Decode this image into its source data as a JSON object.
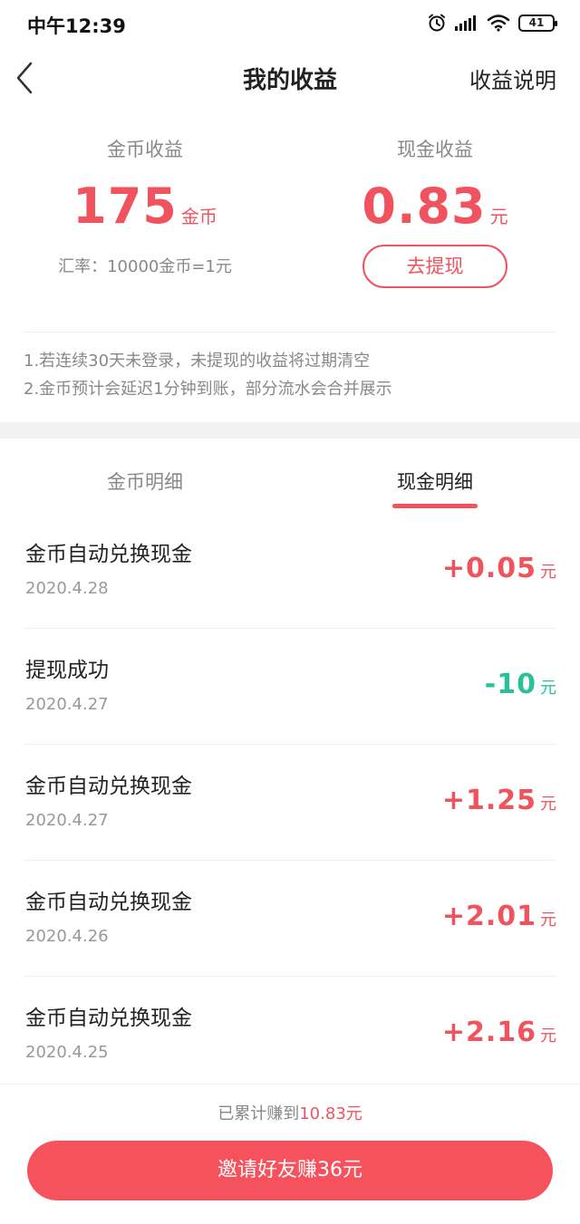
{
  "status_bar": {
    "time": "中午12:39",
    "battery": "41",
    "icons": [
      "alarm-icon",
      "signal-icon",
      "wifi-icon",
      "battery-icon"
    ]
  },
  "nav": {
    "back_icon": "chevron-left-icon",
    "title": "我的收益",
    "right_link": "收益说明"
  },
  "summary": {
    "coin": {
      "label": "金币收益",
      "value": "175",
      "unit": "金币",
      "rate": "汇率：10000金币=1元"
    },
    "cash": {
      "label": "现金收益",
      "value": "0.83",
      "unit": "元",
      "withdraw": "去提现"
    }
  },
  "notes": [
    "1.若连续30天未登录，未提现的收益将过期清空",
    "2.金币预计会延迟1分钟到账，部分流水会合并展示"
  ],
  "tabs": [
    {
      "label": "金币明细",
      "active": false
    },
    {
      "label": "现金明细",
      "active": true
    }
  ],
  "transactions": [
    {
      "title": "金币自动兑换现金",
      "date": "2020.4.28",
      "amount": "+0.05",
      "unit": "元",
      "type": "income"
    },
    {
      "title": "提现成功",
      "date": "2020.4.27",
      "amount": "-10",
      "unit": "元",
      "type": "expense"
    },
    {
      "title": "金币自动兑换现金",
      "date": "2020.4.27",
      "amount": "+1.25",
      "unit": "元",
      "type": "income"
    },
    {
      "title": "金币自动兑换现金",
      "date": "2020.4.26",
      "amount": "+2.01",
      "unit": "元",
      "type": "income"
    },
    {
      "title": "金币自动兑换现金",
      "date": "2020.4.25",
      "amount": "+2.16",
      "unit": "元",
      "type": "income"
    }
  ],
  "footer": {
    "total_prefix": "已累计赚到",
    "total_amount": "10.83元",
    "invite_button": "邀请好友赚36元"
  },
  "colors": {
    "accent": "#f0535e",
    "income": "#f0535e",
    "expense": "#2bbf9a",
    "muted_text": "#888888"
  }
}
